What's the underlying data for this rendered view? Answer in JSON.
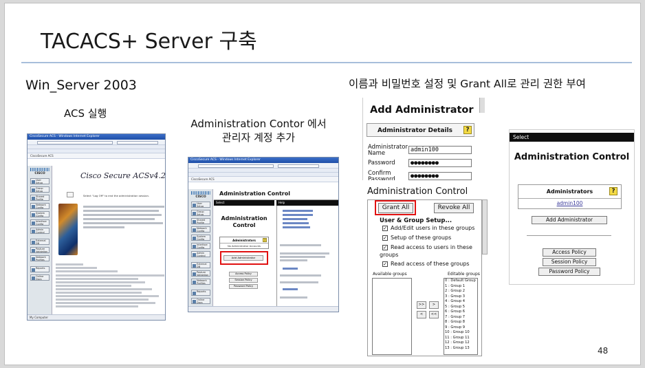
{
  "slide": {
    "title": "TACACS+ Server 구축",
    "page_number": "48"
  },
  "col1": {
    "heading": "Win_Server 2003",
    "subheading": "ACS 실행",
    "browser_title": "CiscoSecure ACS - Windows Internet Explorer",
    "tab_label": "CiscoSecure ACS",
    "brand": "Cisco Secure ACSv4.2",
    "hint": "Select \"Log Off\" to end the administration session.",
    "status": "My Computer"
  },
  "col2": {
    "heading_line1": "Administration Contor 에서",
    "heading_line2": "관리자 계정 추가",
    "browser_title": "CiscoSecure ACS - Windows Internet Explorer",
    "tab_label": "CiscoSecure ACS",
    "header_title": "Administration Control",
    "select_label": "Select",
    "help_label": "Help",
    "panel_title": "Administration Control",
    "table_header": "Administrators",
    "table_row": "No Administrator Accounts",
    "add_button": "Add Administrator",
    "policy_buttons": [
      "Access Policy",
      "Session Policy",
      "Password Policy"
    ]
  },
  "col3": {
    "heading": "이름과 비밀번호 설정 및 Grant All로 관리 권한 부여",
    "add_admin": {
      "title": "Add Administrator",
      "details_label": "Administrator Details",
      "name_label": "Administrator Name",
      "name_value": "admin100",
      "password_label": "Password",
      "password_value": "●●●●●●●●",
      "confirm_label": "Confirm Password",
      "confirm_value": "●●●●●●●●"
    },
    "admin_control": {
      "title": "Administration Control",
      "grant_all": "Grant All",
      "revoke_all": "Revoke All",
      "setup_heading": "User & Group Setup...",
      "checks": [
        "Add/Edit users in these groups",
        "Setup of these groups",
        "Read access to users in these",
        "groups",
        "Read access of these groups"
      ],
      "available_label": "Available groups",
      "editable_label": "Editable groups",
      "arrow_right": ">>",
      "arrow_single_right": ">",
      "arrow_left": "<",
      "arrow_left_all": "<<",
      "groups": [
        "0 : Default Group",
        "1 : Group 1",
        "2 : Group 2",
        "3 : Group 3",
        "4 : Group 4",
        "5 : Group 5",
        "6 : Group 6",
        "7 : Group 7",
        "8 : Group 8",
        "9 : Group 9",
        "10 : Group 10",
        "11 : Group 11",
        "12 : Group 12",
        "13 : Group 13"
      ]
    },
    "result": {
      "select_label": "Select",
      "title": "Administration Control",
      "table_header": "Administrators",
      "admin_row": "admin100",
      "add_button": "Add Administrator",
      "policy_buttons": [
        "Access Policy",
        "Session Policy",
        "Password Policy"
      ]
    }
  }
}
